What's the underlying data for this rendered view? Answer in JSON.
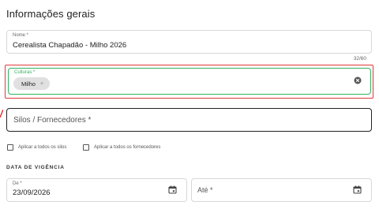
{
  "title": "Informações gerais",
  "nome": {
    "label": "Nome *",
    "value": "Cerealista Chapadão - Milho 2026",
    "counter": "32/60"
  },
  "culturas": {
    "label": "Culturas *",
    "chips": [
      "Milho"
    ]
  },
  "silos": {
    "placeholder": "Silos / Fornecedores *"
  },
  "checkboxes": {
    "silos": "Aplicar a todos os silos",
    "fornecedores": "Aplicar a todos os fornecedores"
  },
  "vigencia": {
    "section_title": "DATA DE VIGÊNCIA",
    "de": {
      "label": "De *",
      "value": "23/09/2026"
    },
    "ate": {
      "placeholder": "Até *"
    }
  },
  "colors": {
    "error": "#e03a3a",
    "focus": "#33b05f"
  }
}
